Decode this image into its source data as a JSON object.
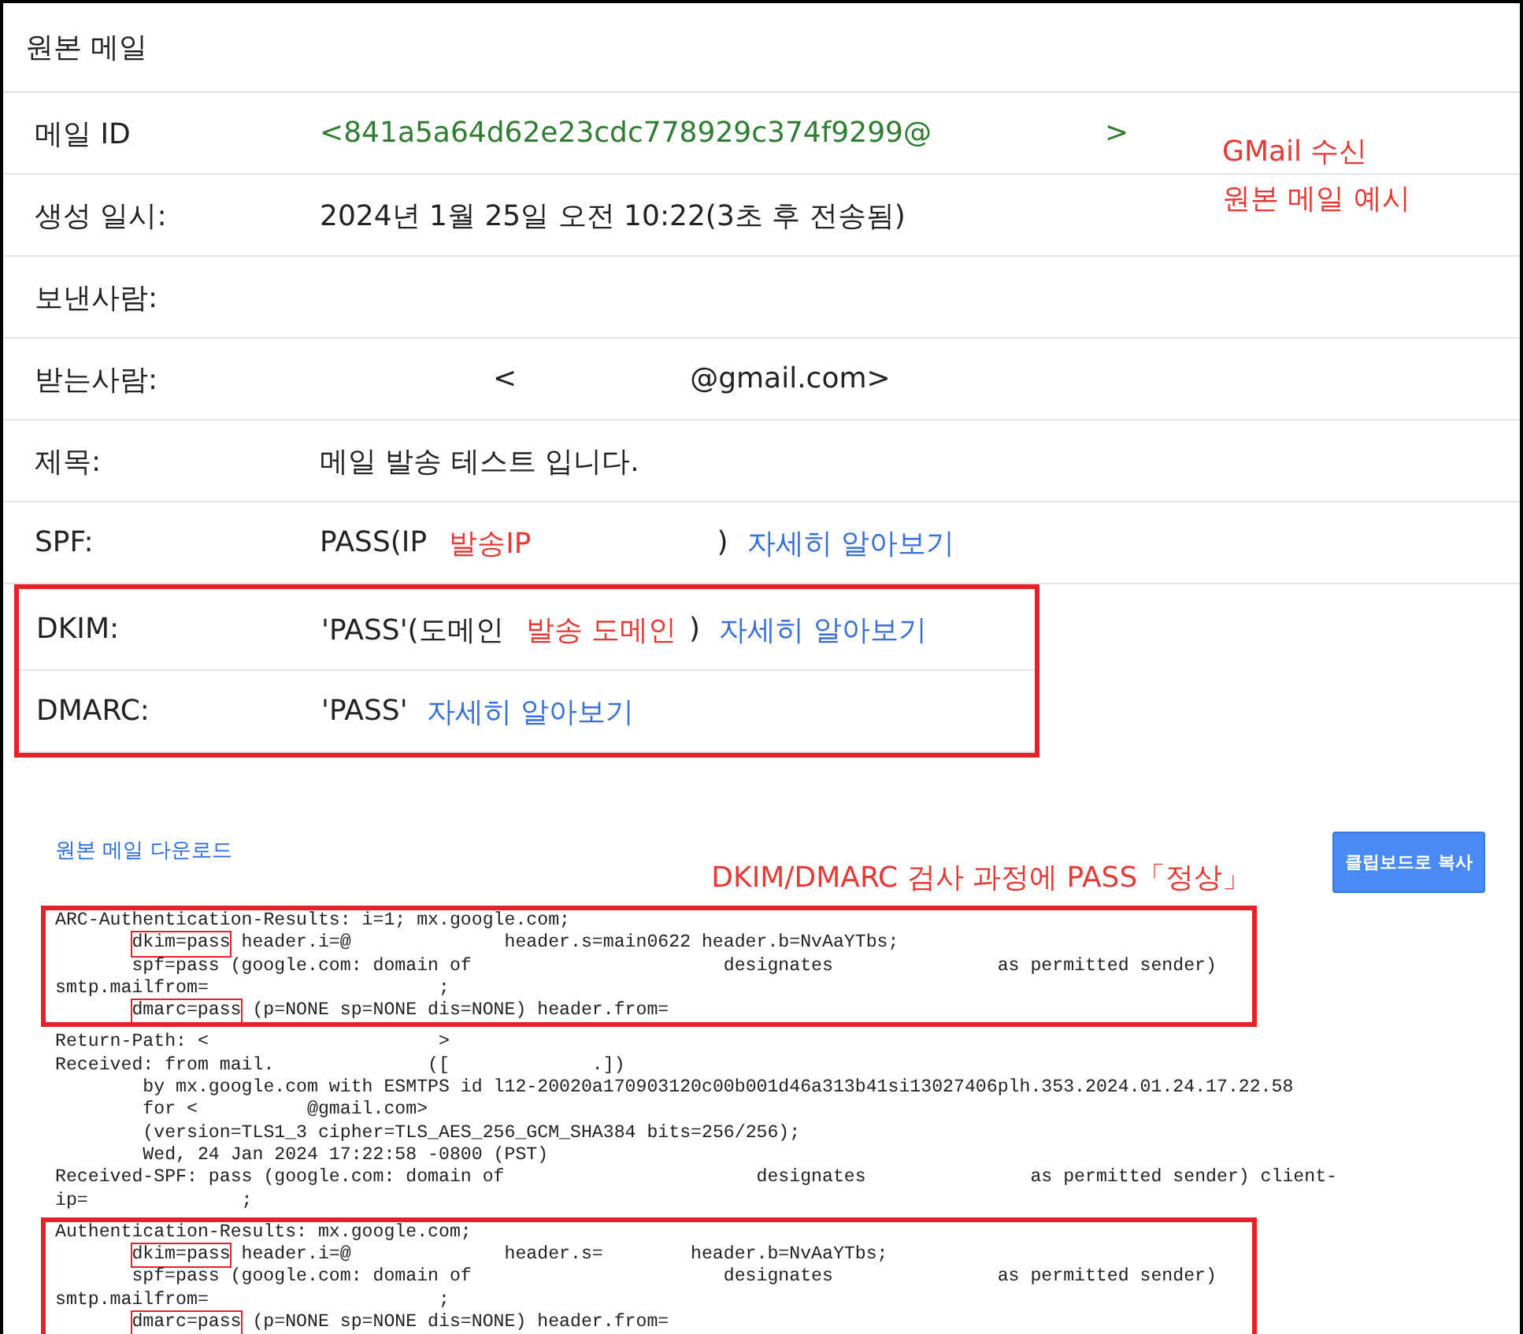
{
  "title": "원본 메일",
  "note_lines": [
    "GMail 수신",
    "원본 메일 예시"
  ],
  "rows": [
    {
      "label": "메일 ID",
      "highlighted": false,
      "value": [
        {
          "kind": "id",
          "text": "<841a5a64d62e23cdc778929c374f9299@",
          "gap": false
        },
        {
          "kind": "id",
          "text": ">",
          "gap": true
        }
      ]
    },
    {
      "label": "생성 일시:",
      "highlighted": false,
      "value": [
        {
          "kind": "text",
          "text": "2024년 1월 25일 오전 10:22(3초 후 전송됨)",
          "gap": false
        }
      ]
    },
    {
      "label": "보낸사람:",
      "highlighted": false,
      "value": []
    },
    {
      "label": "받는사람:",
      "highlighted": false,
      "value": [
        {
          "kind": "text",
          "text": "<",
          "gap": true
        },
        {
          "kind": "text",
          "text": "@gmail.com>",
          "gap": true
        }
      ]
    },
    {
      "label": "제목:",
      "highlighted": false,
      "value": [
        {
          "kind": "text",
          "text": "메일 발송 테스트 입니다.",
          "gap": false
        }
      ]
    },
    {
      "label": "SPF:",
      "highlighted": false,
      "value": [
        {
          "kind": "text",
          "text": "PASS(IP",
          "gap": false
        },
        {
          "kind": "note",
          "text": "발송IP",
          "gap": false
        },
        {
          "kind": "text",
          "text": ")",
          "gap": true
        },
        {
          "kind": "link",
          "text": "자세히 알아보기",
          "gap": false
        }
      ]
    },
    {
      "label": "DKIM:",
      "highlighted": true,
      "value": [
        {
          "kind": "text",
          "text": "'PASS'(도메인",
          "gap": false
        },
        {
          "kind": "note",
          "text": "발송 도메인",
          "gap": false
        },
        {
          "kind": "text",
          "text": ")",
          "gap": false
        },
        {
          "kind": "link",
          "text": "자세히 알아보기",
          "gap": false
        }
      ]
    },
    {
      "label": "DMARC:",
      "highlighted": true,
      "value": [
        {
          "kind": "text",
          "text": "'PASS'",
          "gap": false
        },
        {
          "kind": "link",
          "text": "자세히 알아보기",
          "gap": false
        }
      ]
    }
  ],
  "download_link": "원본 메일 다운로드",
  "code_note": "DKIM/DMARC 검사 과정에 PASS「정상」",
  "copy_button": "클립보드로 복사",
  "code_blocks": [
    {
      "highlighted": true,
      "lines": [
        {
          "indent": false,
          "parts": [
            {
              "text": "ARC-Authentication-Results: i=1; mx.google.com;",
              "boxed": false
            }
          ]
        },
        {
          "indent": true,
          "parts": [
            {
              "text": "dkim=pass",
              "boxed": true
            },
            {
              "text": " header.i=@              header.s=main0622 header.b=NvAaYTbs;",
              "boxed": false
            }
          ]
        },
        {
          "indent": true,
          "parts": [
            {
              "text": "spf=pass (google.com: domain of                       designates               as permitted sender)",
              "boxed": false
            }
          ]
        },
        {
          "indent": false,
          "parts": [
            {
              "text": "smtp.mailfrom=                     ;",
              "boxed": false
            }
          ]
        },
        {
          "indent": true,
          "parts": [
            {
              "text": "dmarc=pass",
              "boxed": true
            },
            {
              "text": " (p=NONE sp=NONE dis=NONE) header.from=",
              "boxed": false
            }
          ]
        }
      ]
    },
    {
      "highlighted": false,
      "lines": [
        {
          "indent": false,
          "parts": [
            {
              "text": "Return-Path: <                     >",
              "boxed": false
            }
          ]
        },
        {
          "indent": false,
          "parts": [
            {
              "text": "Received: from mail.              ([             .])",
              "boxed": false
            }
          ]
        },
        {
          "indent": false,
          "parts": [
            {
              "text": "        by mx.google.com with ESMTPS id l12-20020a170903120c00b001d46a313b41si13027406plh.353.2024.01.24.17.22.58",
              "boxed": false
            }
          ]
        },
        {
          "indent": false,
          "parts": [
            {
              "text": "        for <          @gmail.com>",
              "boxed": false
            }
          ]
        },
        {
          "indent": false,
          "parts": [
            {
              "text": "        (version=TLS1_3 cipher=TLS_AES_256_GCM_SHA384 bits=256/256);",
              "boxed": false
            }
          ]
        },
        {
          "indent": false,
          "parts": [
            {
              "text": "        Wed, 24 Jan 2024 17:22:58 -0800 (PST)",
              "boxed": false
            }
          ]
        },
        {
          "indent": false,
          "parts": [
            {
              "text": "Received-SPF: pass (google.com: domain of                       designates               as permitted sender) client-",
              "boxed": false
            }
          ]
        },
        {
          "indent": false,
          "parts": [
            {
              "text": "ip=              ;",
              "boxed": false
            }
          ]
        }
      ]
    },
    {
      "highlighted": true,
      "lines": [
        {
          "indent": false,
          "parts": [
            {
              "text": "Authentication-Results: mx.google.com;",
              "boxed": false
            }
          ]
        },
        {
          "indent": true,
          "parts": [
            {
              "text": "dkim=pass",
              "boxed": true
            },
            {
              "text": " header.i=@              header.s=        header.b=NvAaYTbs;",
              "boxed": false
            }
          ]
        },
        {
          "indent": true,
          "parts": [
            {
              "text": "spf=pass (google.com: domain of                       designates               as permitted sender)",
              "boxed": false
            }
          ]
        },
        {
          "indent": false,
          "parts": [
            {
              "text": "smtp.mailfrom=                     ;",
              "boxed": false
            }
          ]
        },
        {
          "indent": true,
          "parts": [
            {
              "text": "dmarc=pass",
              "boxed": true
            },
            {
              "text": " (p=NONE sp=NONE dis=NONE) header.from=",
              "boxed": false
            }
          ]
        }
      ]
    }
  ]
}
